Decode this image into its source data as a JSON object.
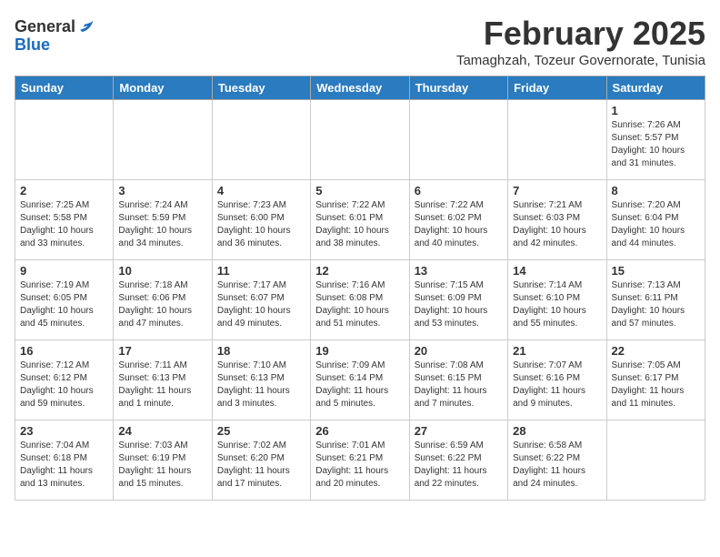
{
  "header": {
    "logo_general": "General",
    "logo_blue": "Blue",
    "month_year": "February 2025",
    "location": "Tamaghzah, Tozeur Governorate, Tunisia"
  },
  "days_of_week": [
    "Sunday",
    "Monday",
    "Tuesday",
    "Wednesday",
    "Thursday",
    "Friday",
    "Saturday"
  ],
  "weeks": [
    [
      {
        "day": "",
        "info": ""
      },
      {
        "day": "",
        "info": ""
      },
      {
        "day": "",
        "info": ""
      },
      {
        "day": "",
        "info": ""
      },
      {
        "day": "",
        "info": ""
      },
      {
        "day": "",
        "info": ""
      },
      {
        "day": "1",
        "info": "Sunrise: 7:26 AM\nSunset: 5:57 PM\nDaylight: 10 hours and 31 minutes."
      }
    ],
    [
      {
        "day": "2",
        "info": "Sunrise: 7:25 AM\nSunset: 5:58 PM\nDaylight: 10 hours and 33 minutes."
      },
      {
        "day": "3",
        "info": "Sunrise: 7:24 AM\nSunset: 5:59 PM\nDaylight: 10 hours and 34 minutes."
      },
      {
        "day": "4",
        "info": "Sunrise: 7:23 AM\nSunset: 6:00 PM\nDaylight: 10 hours and 36 minutes."
      },
      {
        "day": "5",
        "info": "Sunrise: 7:22 AM\nSunset: 6:01 PM\nDaylight: 10 hours and 38 minutes."
      },
      {
        "day": "6",
        "info": "Sunrise: 7:22 AM\nSunset: 6:02 PM\nDaylight: 10 hours and 40 minutes."
      },
      {
        "day": "7",
        "info": "Sunrise: 7:21 AM\nSunset: 6:03 PM\nDaylight: 10 hours and 42 minutes."
      },
      {
        "day": "8",
        "info": "Sunrise: 7:20 AM\nSunset: 6:04 PM\nDaylight: 10 hours and 44 minutes."
      }
    ],
    [
      {
        "day": "9",
        "info": "Sunrise: 7:19 AM\nSunset: 6:05 PM\nDaylight: 10 hours and 45 minutes."
      },
      {
        "day": "10",
        "info": "Sunrise: 7:18 AM\nSunset: 6:06 PM\nDaylight: 10 hours and 47 minutes."
      },
      {
        "day": "11",
        "info": "Sunrise: 7:17 AM\nSunset: 6:07 PM\nDaylight: 10 hours and 49 minutes."
      },
      {
        "day": "12",
        "info": "Sunrise: 7:16 AM\nSunset: 6:08 PM\nDaylight: 10 hours and 51 minutes."
      },
      {
        "day": "13",
        "info": "Sunrise: 7:15 AM\nSunset: 6:09 PM\nDaylight: 10 hours and 53 minutes."
      },
      {
        "day": "14",
        "info": "Sunrise: 7:14 AM\nSunset: 6:10 PM\nDaylight: 10 hours and 55 minutes."
      },
      {
        "day": "15",
        "info": "Sunrise: 7:13 AM\nSunset: 6:11 PM\nDaylight: 10 hours and 57 minutes."
      }
    ],
    [
      {
        "day": "16",
        "info": "Sunrise: 7:12 AM\nSunset: 6:12 PM\nDaylight: 10 hours and 59 minutes."
      },
      {
        "day": "17",
        "info": "Sunrise: 7:11 AM\nSunset: 6:13 PM\nDaylight: 11 hours and 1 minute."
      },
      {
        "day": "18",
        "info": "Sunrise: 7:10 AM\nSunset: 6:13 PM\nDaylight: 11 hours and 3 minutes."
      },
      {
        "day": "19",
        "info": "Sunrise: 7:09 AM\nSunset: 6:14 PM\nDaylight: 11 hours and 5 minutes."
      },
      {
        "day": "20",
        "info": "Sunrise: 7:08 AM\nSunset: 6:15 PM\nDaylight: 11 hours and 7 minutes."
      },
      {
        "day": "21",
        "info": "Sunrise: 7:07 AM\nSunset: 6:16 PM\nDaylight: 11 hours and 9 minutes."
      },
      {
        "day": "22",
        "info": "Sunrise: 7:05 AM\nSunset: 6:17 PM\nDaylight: 11 hours and 11 minutes."
      }
    ],
    [
      {
        "day": "23",
        "info": "Sunrise: 7:04 AM\nSunset: 6:18 PM\nDaylight: 11 hours and 13 minutes."
      },
      {
        "day": "24",
        "info": "Sunrise: 7:03 AM\nSunset: 6:19 PM\nDaylight: 11 hours and 15 minutes."
      },
      {
        "day": "25",
        "info": "Sunrise: 7:02 AM\nSunset: 6:20 PM\nDaylight: 11 hours and 17 minutes."
      },
      {
        "day": "26",
        "info": "Sunrise: 7:01 AM\nSunset: 6:21 PM\nDaylight: 11 hours and 20 minutes."
      },
      {
        "day": "27",
        "info": "Sunrise: 6:59 AM\nSunset: 6:22 PM\nDaylight: 11 hours and 22 minutes."
      },
      {
        "day": "28",
        "info": "Sunrise: 6:58 AM\nSunset: 6:22 PM\nDaylight: 11 hours and 24 minutes."
      },
      {
        "day": "",
        "info": ""
      }
    ]
  ]
}
